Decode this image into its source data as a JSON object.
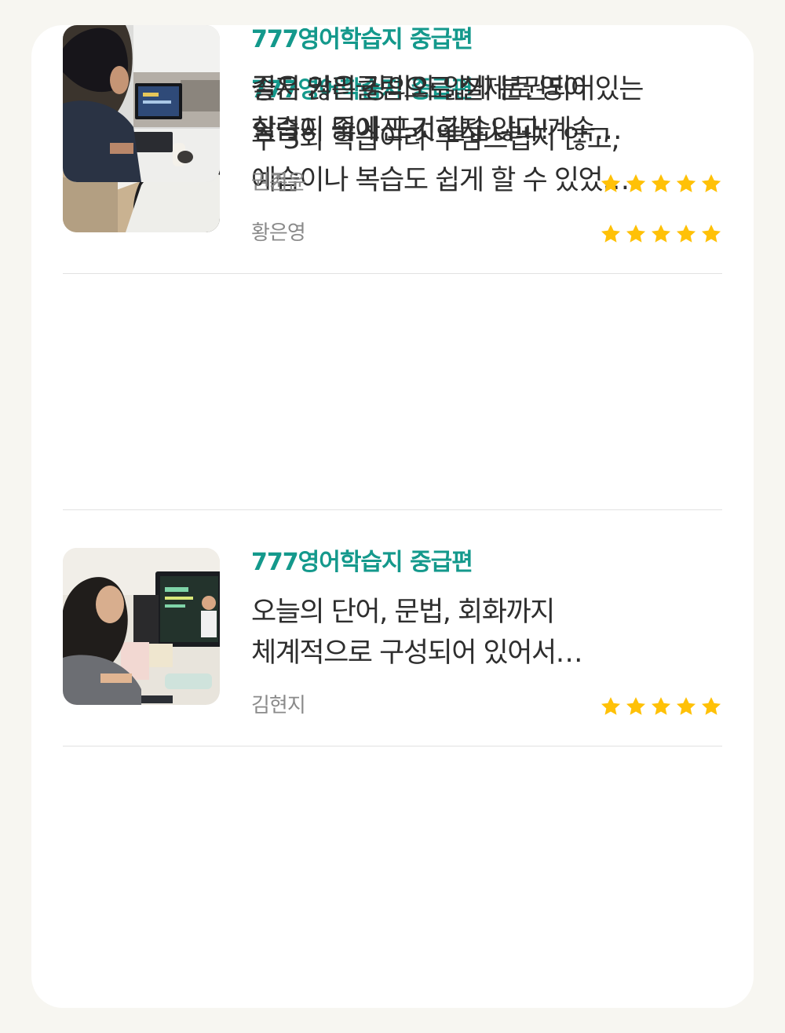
{
  "colors": {
    "page_background": "#f7f6f1",
    "card_background": "#ffffff",
    "product_title": "#14998c",
    "review_text": "#2e2e2e",
    "author": "#8a8a8a",
    "star": "#ffc107",
    "divider": "#e2e2e2"
  },
  "reviews": [
    {
      "product": "777영어학습지 중급편",
      "text_line1": "주 3회 학습이라 부담스럽지 않고,",
      "text_line2": "예습이나 복습도 쉽게 할 수 있었…",
      "author": "황은영",
      "rating": 5,
      "photo_icon": "student-laptop-photo"
    },
    {
      "product": "777영어학습지 중급편",
      "text_line1": "오늘의 단어, 문법, 회화까지",
      "text_line2": "체계적으로 구성되어 있어서…",
      "author": "김현지",
      "rating": 5,
      "photo_icon": "student-monitor-photo"
    },
    {
      "product": "777영어학습지 중급편",
      "text_line1": "길지 않은 강의와 얇게 분권되어있는",
      "text_line2": "학습지 덕에 포기하지 않고 계속…",
      "author": "권준",
      "rating": 5,
      "photo_icon": "student-tablet-photo"
    },
    {
      "product": "777영어학습지 중급편",
      "text_line1": "좋은 커리큘럼으로 실제로 영어",
      "text_line2": "실력이 좋아진 것 같습니다!",
      "author": "권기윤",
      "rating": 5,
      "photo_icon": "student-desk-photo"
    }
  ]
}
